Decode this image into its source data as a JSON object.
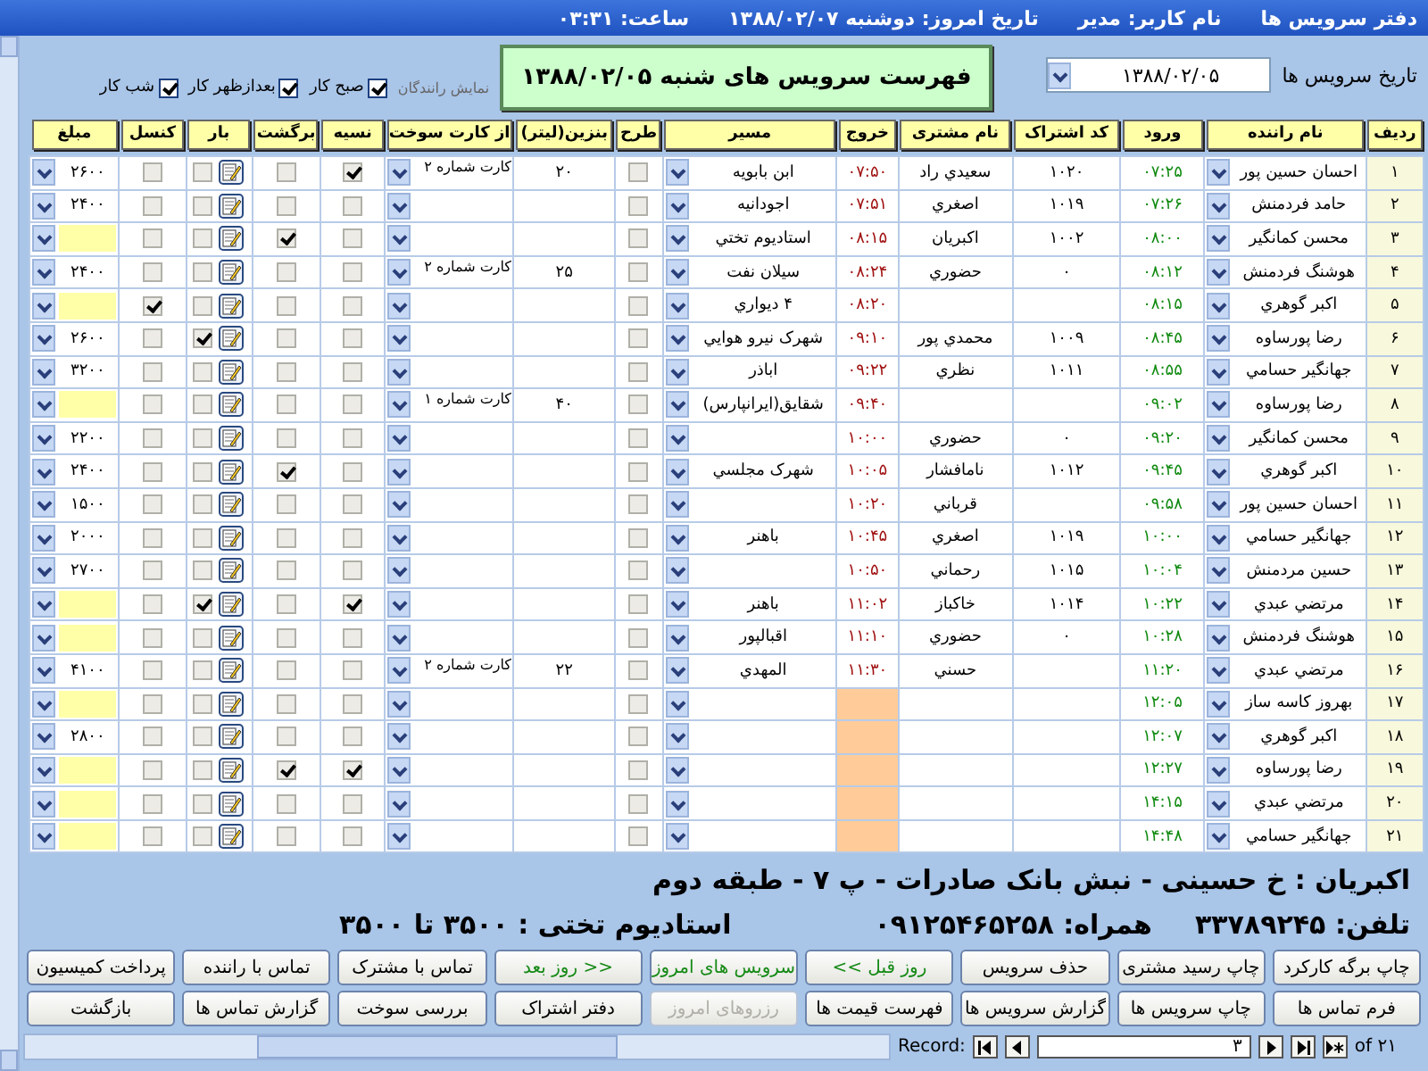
{
  "title_bar": {
    "app": "دفتر سرویس ها",
    "user": "نام کاربر: مدیر",
    "today": "تاریخ امروز: دوشنبه ۱۳۸۸/۰۲/۰۷",
    "clock": "ساعت: ۰۳:۳۱"
  },
  "filter": {
    "date_label": "تاریخ سرویس ها",
    "date_value": "۱۳۸۸/۰۲/۰۵",
    "drivers_label": "نمایش رانندگان",
    "shifts": [
      {
        "label": "صبح کار",
        "checked": true
      },
      {
        "label": "بعدازظهر کار",
        "checked": true
      },
      {
        "label": "شب کار",
        "checked": true
      }
    ]
  },
  "heading": "فهرست سرویس های شنبه ۱۳۸۸/۰۲/۰۵",
  "table": {
    "columns": [
      "ردیف",
      "نام راننده",
      "ورود",
      "کد اشتراک",
      "نام مشتری",
      "خروج",
      "مسیر",
      "طرح",
      "بنزین(لیتر)",
      "از کارت سوخت",
      "نسیه",
      "برگشت",
      "بار",
      "کنسل",
      "مبلغ"
    ],
    "rows": [
      {
        "number": "۱",
        "driver": "احسان حسین پور",
        "arrival": "۰۷:۲۵",
        "subscription_code": "۱۰۲۰",
        "customer": "سعیدي راد",
        "departure": "۰۷:۵۰",
        "route": "ابن بابویه",
        "plan": false,
        "fuel_liters": "۲۰",
        "fuel_card": "کارت شماره ۲",
        "credit": true,
        "return_trip": false,
        "cargo": false,
        "cancelled": false,
        "amount": "۲۶۰۰"
      },
      {
        "number": "۲",
        "driver": "حامد فردمنش",
        "arrival": "۰۷:۲۶",
        "subscription_code": "۱۰۱۹",
        "customer": "اصغري",
        "departure": "۰۷:۵۱",
        "route": "اجودانیه",
        "plan": false,
        "credit": false,
        "return_trip": false,
        "cargo": false,
        "cancelled": false,
        "amount": "۲۴۰۰"
      },
      {
        "number": "۳",
        "driver": "محسن کمانگیر",
        "arrival": "۰۸:۰۰",
        "subscription_code": "۱۰۰۲",
        "customer": "اکبریان",
        "departure": "۰۸:۱۵",
        "route": "استادیوم تختي",
        "plan": false,
        "credit": false,
        "return_trip": true,
        "cargo": false,
        "cancelled": false
      },
      {
        "number": "۴",
        "driver": "هوشنگ فردمنش",
        "arrival": "۰۸:۱۲",
        "subscription_code": "۰",
        "customer": "حضوري",
        "departure": "۰۸:۲۴",
        "route": "سیلان نفت",
        "plan": false,
        "fuel_liters": "۲۵",
        "fuel_card": "کارت شماره ۲",
        "credit": false,
        "return_trip": false,
        "cargo": false,
        "cancelled": false,
        "amount": "۲۴۰۰"
      },
      {
        "number": "۵",
        "driver": "اکبر گوهري",
        "arrival": "۰۸:۱۵",
        "departure": "۰۸:۲۰",
        "route": "۴ دیواري",
        "plan": false,
        "credit": false,
        "return_trip": false,
        "cargo": false,
        "cancelled": true
      },
      {
        "number": "۶",
        "driver": "رضا پورساوه",
        "arrival": "۰۸:۴۵",
        "subscription_code": "۱۰۰۹",
        "customer": "محمدي پور",
        "departure": "۰۹:۱۰",
        "route": "شهرک نیرو هوایي",
        "plan": false,
        "credit": false,
        "return_trip": false,
        "cargo": true,
        "cancelled": false,
        "amount": "۲۶۰۰"
      },
      {
        "number": "۷",
        "driver": "جهانگیر حسامي",
        "arrival": "۰۸:۵۵",
        "subscription_code": "۱۰۱۱",
        "customer": "نظري",
        "departure": "۰۹:۲۲",
        "route": "اباذر",
        "plan": false,
        "credit": false,
        "return_trip": false,
        "cargo": false,
        "cancelled": false,
        "amount": "۳۲۰۰"
      },
      {
        "number": "۸",
        "driver": "رضا پورساوه",
        "arrival": "۰۹:۰۲",
        "departure": "۰۹:۴۰",
        "route": "شقایق(ایرانپارس)",
        "plan": false,
        "fuel_liters": "۴۰",
        "fuel_card": "کارت شماره ۱",
        "credit": false,
        "return_trip": false,
        "cargo": false,
        "cancelled": false
      },
      {
        "number": "۹",
        "driver": "محسن کمانگیر",
        "arrival": "۰۹:۲۰",
        "subscription_code": "۰",
        "customer": "حضوري",
        "departure": "۱۰:۰۰",
        "plan": false,
        "credit": false,
        "return_trip": false,
        "cargo": false,
        "cancelled": false,
        "amount": "۲۲۰۰"
      },
      {
        "number": "۱۰",
        "driver": "اکبر گوهري",
        "arrival": "۰۹:۴۵",
        "subscription_code": "۱۰۱۲",
        "customer": "نامافشار",
        "departure": "۱۰:۰۵",
        "route": "شهرک مجلسي",
        "plan": false,
        "credit": false,
        "return_trip": true,
        "cargo": false,
        "cancelled": false,
        "amount": "۲۴۰۰"
      },
      {
        "number": "۱۱",
        "driver": "احسان حسین پور",
        "arrival": "۰۹:۵۸",
        "customer": "قرباني",
        "departure": "۱۰:۲۰",
        "plan": false,
        "credit": false,
        "return_trip": false,
        "cargo": false,
        "cancelled": false,
        "amount": "۱۵۰۰"
      },
      {
        "number": "۱۲",
        "driver": "جهانگیر حسامي",
        "arrival": "۱۰:۰۰",
        "subscription_code": "۱۰۱۹",
        "customer": "اصغري",
        "departure": "۱۰:۴۵",
        "route": "باهنر",
        "plan": false,
        "credit": false,
        "return_trip": false,
        "cargo": false,
        "cancelled": false,
        "amount": "۲۰۰۰"
      },
      {
        "number": "۱۳",
        "driver": "حسین مردمنش",
        "arrival": "۱۰:۰۴",
        "subscription_code": "۱۰۱۵",
        "customer": "رحماني",
        "departure": "۱۰:۵۰",
        "plan": false,
        "credit": false,
        "return_trip": false,
        "cargo": false,
        "cancelled": false,
        "amount": "۲۷۰۰"
      },
      {
        "number": "۱۴",
        "driver": "مرتضي عبدي",
        "arrival": "۱۰:۲۲",
        "subscription_code": "۱۰۱۴",
        "customer": "خاکباز",
        "departure": "۱۱:۰۲",
        "route": "باهنر",
        "plan": false,
        "credit": true,
        "return_trip": false,
        "cargo": true,
        "cancelled": false
      },
      {
        "number": "۱۵",
        "driver": "هوشنگ فردمنش",
        "arrival": "۱۰:۲۸",
        "subscription_code": "۰",
        "customer": "حضوري",
        "departure": "۱۱:۱۰",
        "route": "اقبالپور",
        "plan": false,
        "credit": false,
        "return_trip": false,
        "cargo": false,
        "cancelled": false
      },
      {
        "number": "۱۶",
        "driver": "مرتضي عبدي",
        "arrival": "۱۱:۲۰",
        "customer": "حسني",
        "departure": "۱۱:۳۰",
        "route": "المهدي",
        "plan": false,
        "fuel_liters": "۲۲",
        "fuel_card": "کارت شماره ۲",
        "credit": false,
        "return_trip": false,
        "cargo": false,
        "cancelled": false,
        "amount": "۴۱۰۰"
      },
      {
        "number": "۱۷",
        "driver": "بهروز کاسه ساز",
        "arrival": "۱۲:۰۵",
        "plan": false,
        "credit": false,
        "return_trip": false,
        "cargo": false,
        "cancelled": false
      },
      {
        "number": "۱۸",
        "driver": "اکبر گوهري",
        "arrival": "۱۲:۰۷",
        "plan": false,
        "credit": false,
        "return_trip": false,
        "cargo": false,
        "cancelled": false,
        "amount": "۲۸۰۰"
      },
      {
        "number": "۱۹",
        "driver": "رضا پورساوه",
        "arrival": "۱۲:۲۷",
        "plan": false,
        "credit": true,
        "return_trip": true,
        "cargo": false,
        "cancelled": false
      },
      {
        "number": "۲۰",
        "driver": "مرتضي عبدي",
        "arrival": "۱۴:۱۵",
        "plan": false,
        "credit": false,
        "return_trip": false,
        "cargo": false,
        "cancelled": false
      },
      {
        "number": "۲۱",
        "driver": "جهانگیر حسامي",
        "arrival": "۱۴:۴۸",
        "plan": false,
        "credit": false,
        "return_trip": false,
        "cargo": false,
        "cancelled": false
      }
    ]
  },
  "info": {
    "address": "اکبریان : خ حسینی - نبش بانک صادرات - پ ۷ - طبقه دوم",
    "phone": "تلفن: ۳۳۷۸۹۲۴۵",
    "mobile": "همراه: ۰۹۱۲۵۴۶۵۲۵۸",
    "price": "استادیوم تختی : ۳۵۰۰ تا ۳۵۰۰"
  },
  "buttons": [
    [
      {
        "label": "چاپ برگه کارکرد",
        "kind": "normal",
        "disabled": false
      },
      {
        "label": "چاپ رسید مشتری",
        "kind": "normal",
        "disabled": false
      },
      {
        "label": "حذف سرویس",
        "kind": "normal",
        "disabled": false
      },
      {
        "label": "<< روز قبل",
        "kind": "nav",
        "disabled": false
      },
      {
        "label": "سرویس های امروز",
        "kind": "nav",
        "disabled": false
      },
      {
        "label": "روز بعد >>",
        "kind": "nav",
        "disabled": false
      },
      {
        "label": "تماس با مشترک",
        "kind": "normal",
        "disabled": false
      },
      {
        "label": "تماس با راننده",
        "kind": "normal",
        "disabled": false
      },
      {
        "label": "پرداخت کمیسیون",
        "kind": "normal",
        "disabled": false
      }
    ],
    [
      {
        "label": "فرم تماس ها",
        "kind": "normal",
        "disabled": false
      },
      {
        "label": "چاپ سرویس ها",
        "kind": "normal",
        "disabled": false
      },
      {
        "label": "گزارش سرویس ها",
        "kind": "normal",
        "disabled": false
      },
      {
        "label": "فهرست قیمت ها",
        "kind": "normal",
        "disabled": false
      },
      {
        "label": "رزروهای امروز",
        "kind": "normal",
        "disabled": true
      },
      {
        "label": "دفتر اشتراک",
        "kind": "normal",
        "disabled": false
      },
      {
        "label": "بررسی سوخت",
        "kind": "normal",
        "disabled": false
      },
      {
        "label": "گزارش تماس ها",
        "kind": "normal",
        "disabled": false
      },
      {
        "label": "بازگشت",
        "kind": "normal",
        "disabled": false
      }
    ]
  ],
  "record_nav": {
    "label": "Record:",
    "current": "۳",
    "total": "of ۲۱"
  }
}
